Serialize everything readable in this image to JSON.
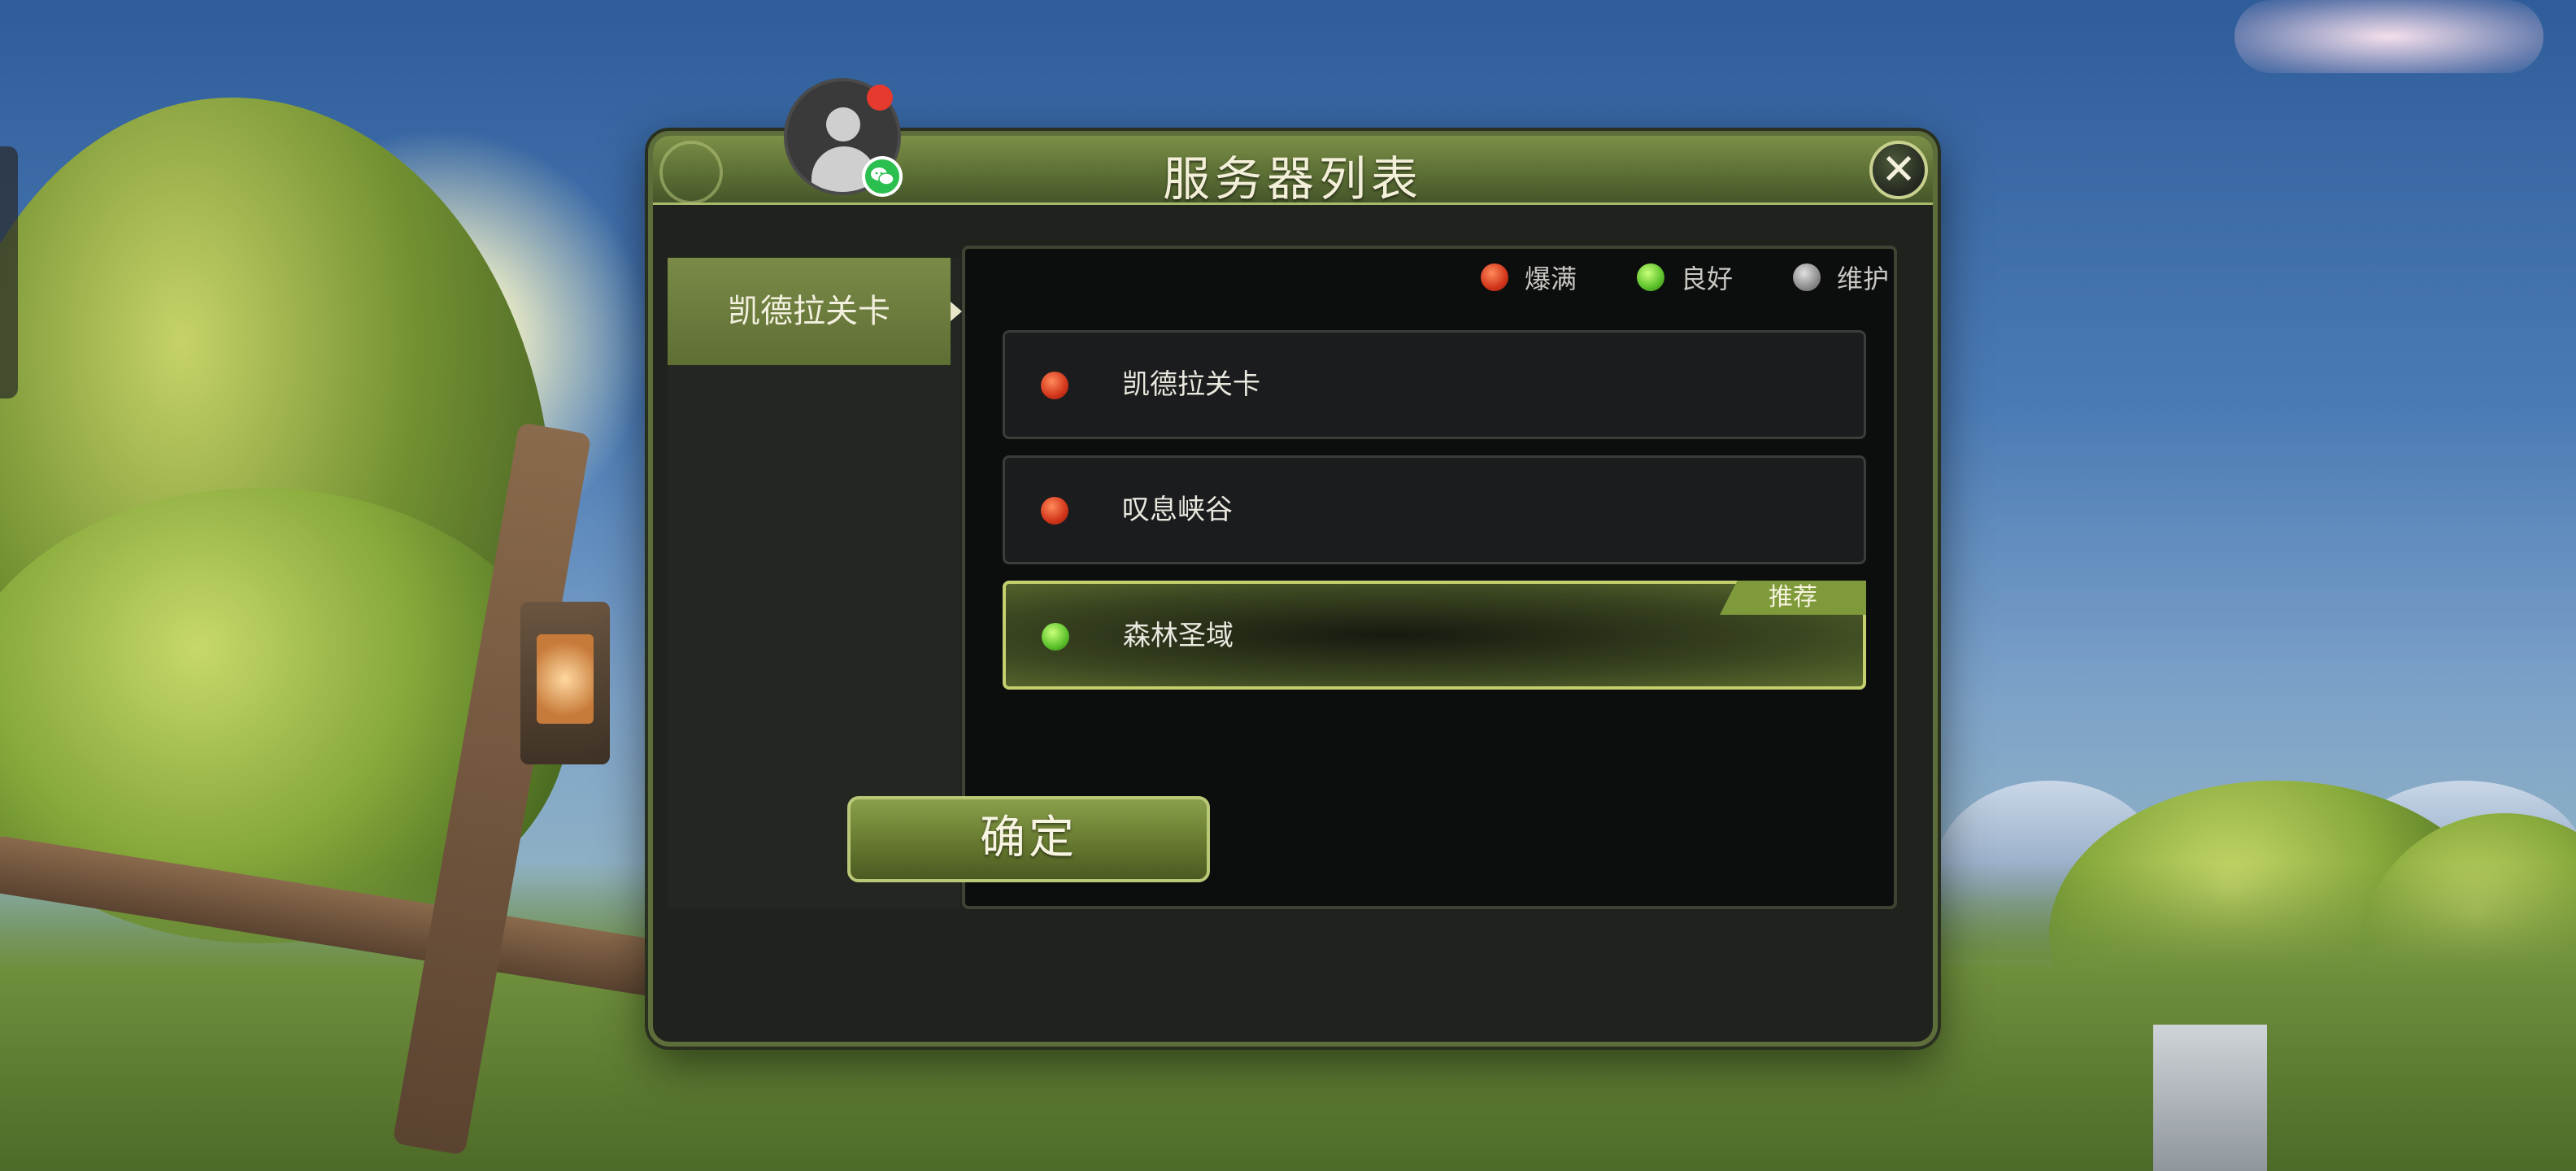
{
  "dialog": {
    "title": "服务器列表",
    "close_icon": "close-icon"
  },
  "profile": {
    "avatar_icon": "user-avatar-icon",
    "badge_icon": "wechat-icon",
    "notification_color": "#e63a2e"
  },
  "sidebar": {
    "items": [
      {
        "label": "凯德拉关卡",
        "selected": true
      }
    ]
  },
  "legend": [
    {
      "label": "爆满",
      "status": "full",
      "color": "#d2351b"
    },
    {
      "label": "良好",
      "status": "good",
      "color": "#5cc12b"
    },
    {
      "label": "维护",
      "status": "maintenance",
      "color": "#8c8c8c"
    }
  ],
  "servers": [
    {
      "name": "凯德拉关卡",
      "status": "full",
      "selected": false
    },
    {
      "name": "叹息峡谷",
      "status": "full",
      "selected": false
    },
    {
      "name": "森林圣域",
      "status": "good",
      "selected": true,
      "tag": "推荐"
    }
  ],
  "confirm_label": "确定",
  "colors": {
    "accent_green": "#7a8a47",
    "border_highlight": "#c3d06d"
  }
}
